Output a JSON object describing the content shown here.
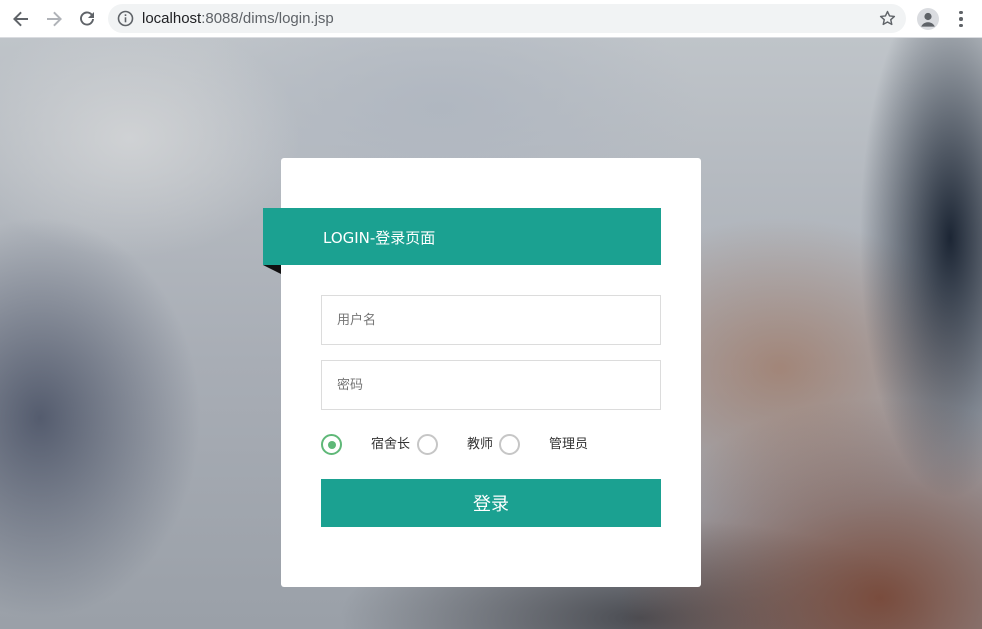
{
  "browser": {
    "url_host": "localhost",
    "url_path": ":8088/dims/login.jsp",
    "icons": [
      "back-arrow-icon",
      "forward-arrow-icon",
      "reload-icon",
      "info-icon",
      "star-icon",
      "profile-icon",
      "menu-dots-icon"
    ]
  },
  "login": {
    "title": "LOGIN-登录页面",
    "username_placeholder": "用户名",
    "password_placeholder": "密码",
    "roles": [
      {
        "label": "宿舍长",
        "checked": true
      },
      {
        "label": "教师",
        "checked": false
      },
      {
        "label": "管理员",
        "checked": false
      }
    ],
    "submit_label": "登录"
  },
  "colors": {
    "accent": "#1ba191",
    "radio_checked": "#5fb878"
  }
}
